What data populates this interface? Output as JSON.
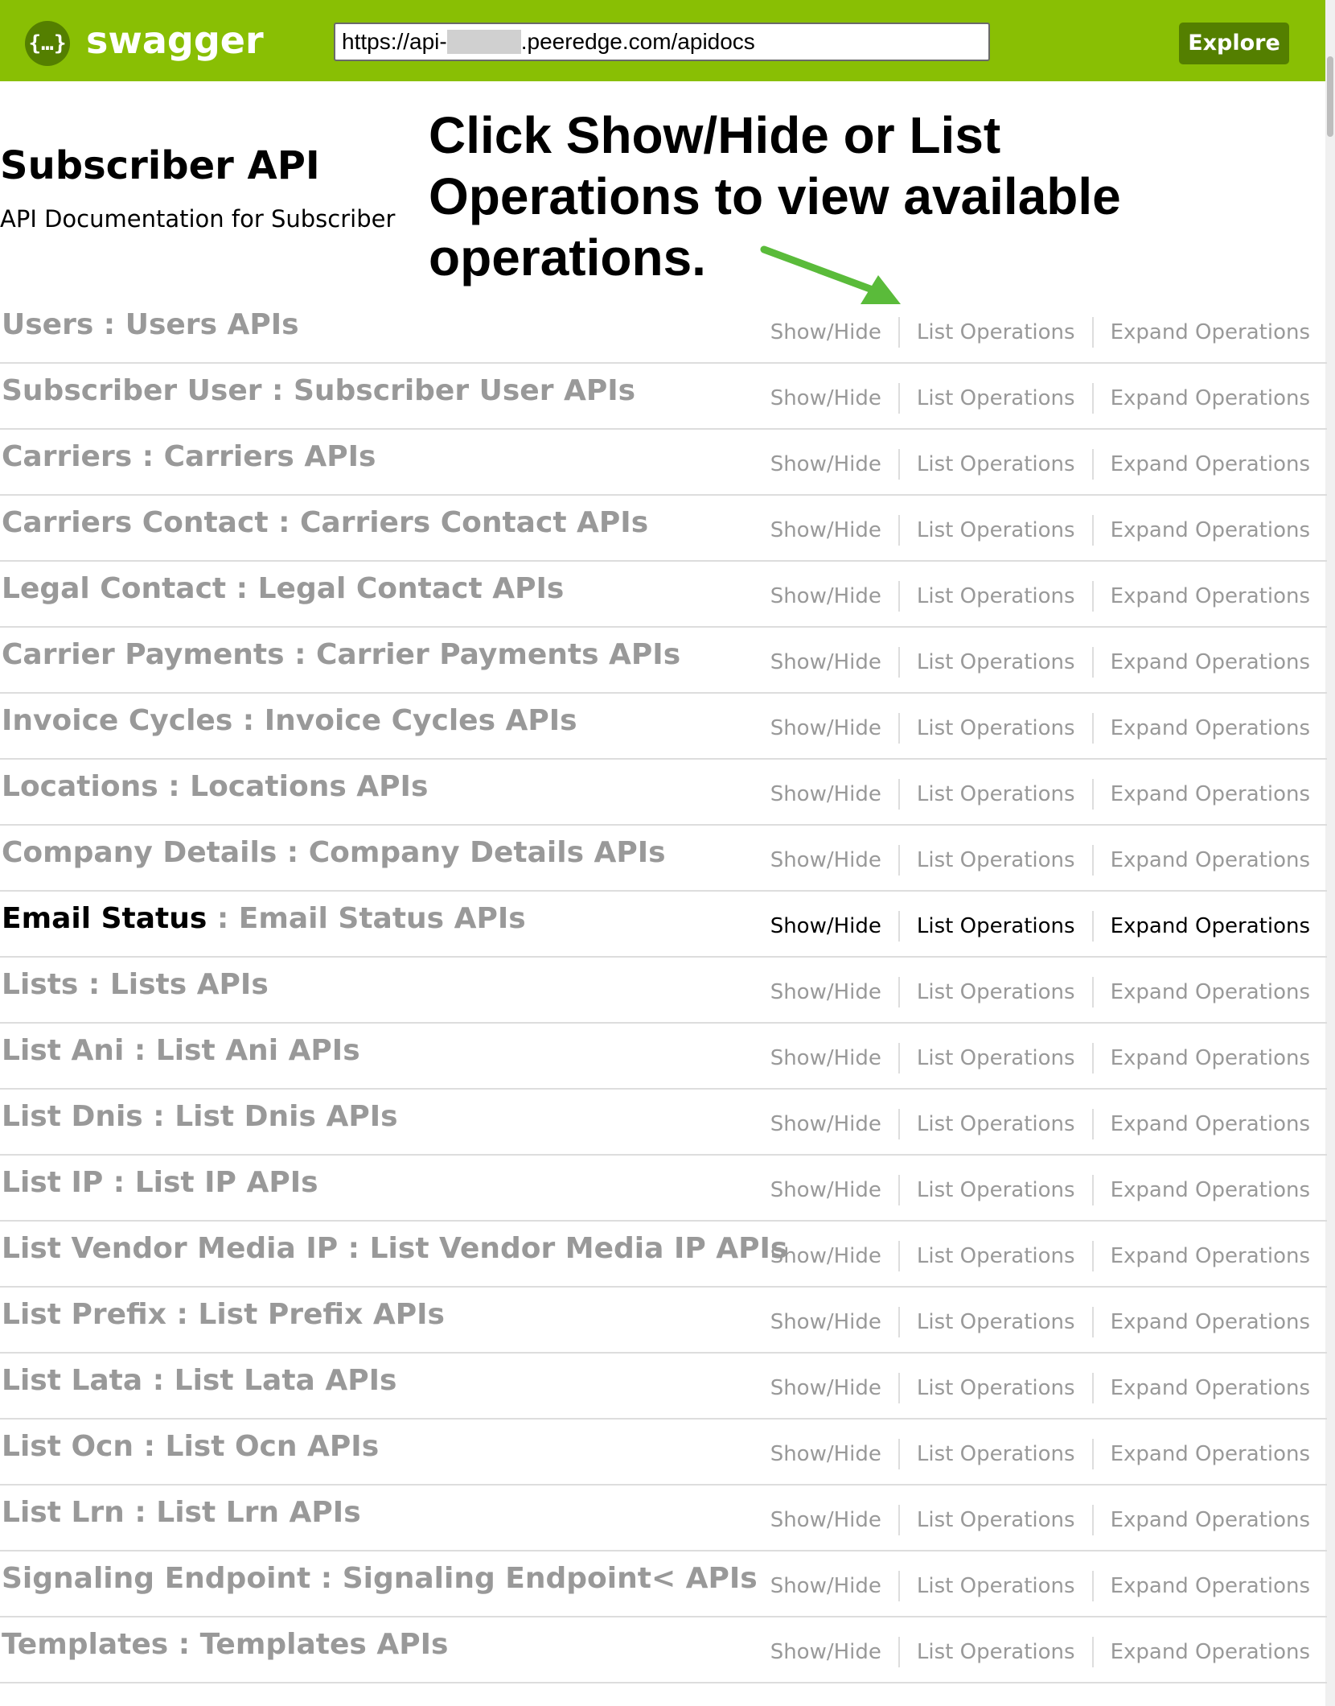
{
  "header": {
    "logo_glyph": "{…}",
    "logo_text": "swagger",
    "url_prefix": "https://api-",
    "url_suffix": ".peeredge.com/apidocs",
    "explore_label": "Explore",
    "bg_color": "#89bf04",
    "button_color": "#547f00"
  },
  "info": {
    "title": "Subscriber API",
    "description": "API Documentation for Subscriber"
  },
  "callout": {
    "text": "Click Show/Hide or List Operations to view available operations.",
    "arrow_color": "#5abb3a"
  },
  "operations": {
    "show_hide": "Show/Hide",
    "list": "List Operations",
    "expand": "Expand Operations"
  },
  "resources": [
    {
      "name": "Users",
      "description": "Users APIs"
    },
    {
      "name": "Subscriber User",
      "description": "Subscriber User APIs"
    },
    {
      "name": "Carriers",
      "description": "Carriers APIs"
    },
    {
      "name": "Carriers Contact",
      "description": "Carriers Contact APIs"
    },
    {
      "name": "Legal Contact",
      "description": "Legal Contact APIs"
    },
    {
      "name": "Carrier Payments",
      "description": "Carrier Payments APIs"
    },
    {
      "name": "Invoice Cycles",
      "description": "Invoice Cycles APIs"
    },
    {
      "name": "Locations",
      "description": "Locations APIs"
    },
    {
      "name": "Company Details",
      "description": "Company Details APIs"
    },
    {
      "name": "Email Status",
      "description": "Email Status APIs",
      "active": true
    },
    {
      "name": "Lists",
      "description": "Lists APIs"
    },
    {
      "name": "List Ani",
      "description": "List Ani APIs"
    },
    {
      "name": "List Dnis",
      "description": "List Dnis APIs"
    },
    {
      "name": "List IP",
      "description": "List IP APIs"
    },
    {
      "name": "List Vendor Media IP",
      "description": "List Vendor Media IP APIs"
    },
    {
      "name": "List Prefix",
      "description": "List Prefix APIs"
    },
    {
      "name": "List Lata",
      "description": "List Lata APIs"
    },
    {
      "name": "List Ocn",
      "description": "List Ocn APIs"
    },
    {
      "name": "List Lrn",
      "description": "List Lrn APIs"
    },
    {
      "name": "Signaling Endpoint",
      "description": "Signaling Endpoint< APIs"
    },
    {
      "name": "Templates",
      "description": "Templates APIs"
    }
  ]
}
